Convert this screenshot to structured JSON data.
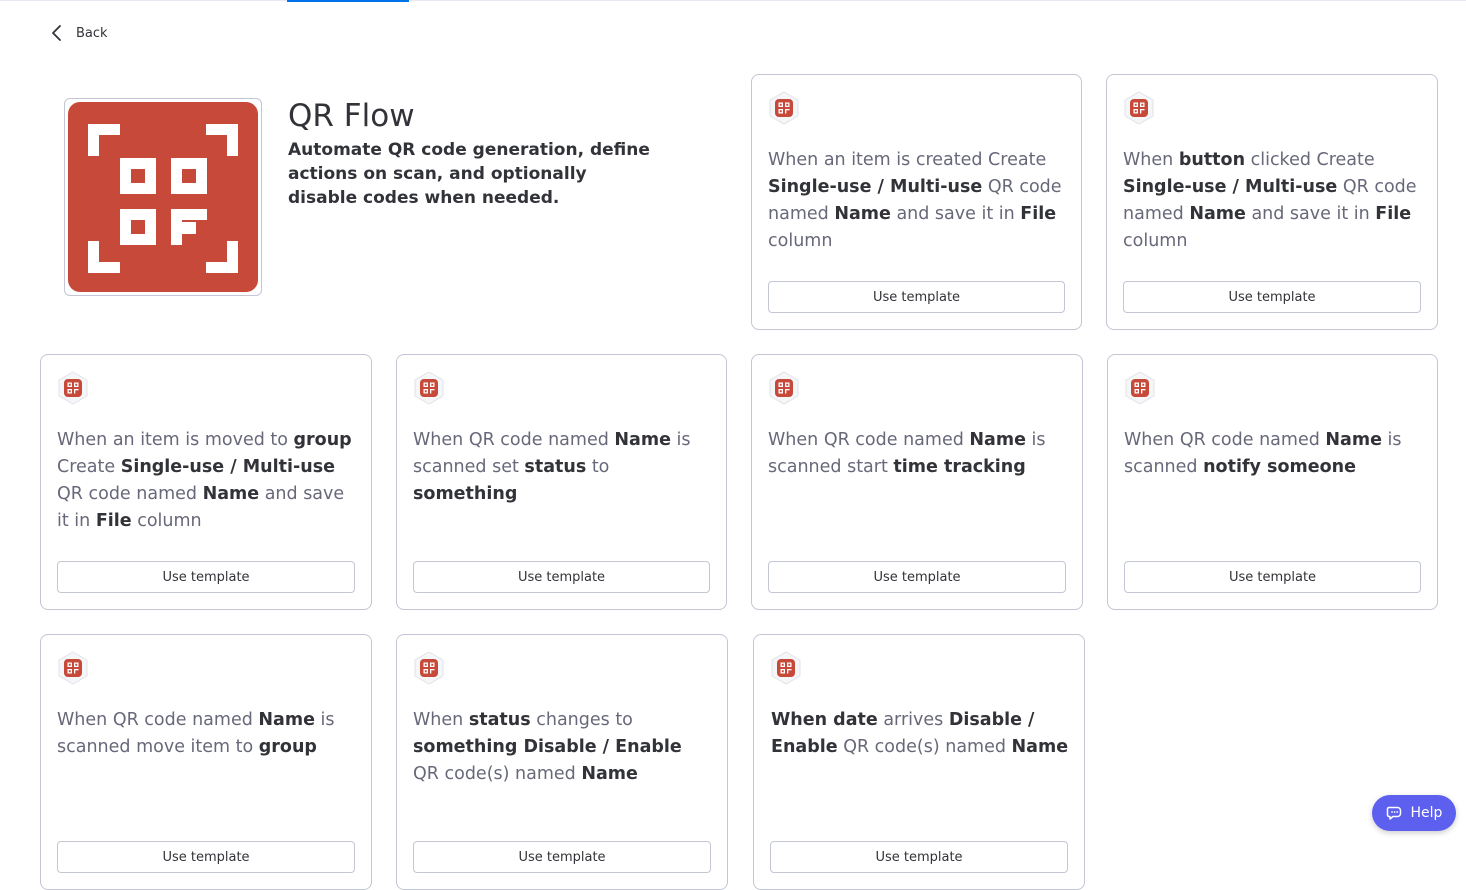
{
  "nav": {
    "back_label": "Back"
  },
  "app": {
    "title": "QR Flow",
    "description": "Automate QR code generation, define actions on scan, and optionally disable codes when needed."
  },
  "colors": {
    "brand": "#c7493a",
    "help": "#5d5fef",
    "accent_tab": "#0073ea"
  },
  "cards": [
    {
      "segments": [
        {
          "t": "When an item is created Create ",
          "b": false
        },
        {
          "t": "Single-use / Multi-use",
          "b": true
        },
        {
          "t": " QR code named ",
          "b": false
        },
        {
          "t": "Name",
          "b": true
        },
        {
          "t": " and save it in ",
          "b": false
        },
        {
          "t": "File",
          "b": true
        },
        {
          "t": " column",
          "b": false
        }
      ],
      "button": "Use template"
    },
    {
      "segments": [
        {
          "t": "When ",
          "b": false
        },
        {
          "t": "button",
          "b": true
        },
        {
          "t": " clicked Create ",
          "b": false
        },
        {
          "t": "Single-use / Multi-use",
          "b": true
        },
        {
          "t": " QR code named ",
          "b": false
        },
        {
          "t": "Name",
          "b": true
        },
        {
          "t": " and save it in ",
          "b": false
        },
        {
          "t": "File",
          "b": true
        },
        {
          "t": " column",
          "b": false
        }
      ],
      "button": "Use template"
    },
    {
      "segments": [
        {
          "t": "When an item is moved to ",
          "b": false
        },
        {
          "t": "group",
          "b": true
        },
        {
          "t": " Create ",
          "b": false
        },
        {
          "t": "Single-use / Multi-use",
          "b": true
        },
        {
          "t": " QR code named ",
          "b": false
        },
        {
          "t": "Name",
          "b": true
        },
        {
          "t": " and save it in ",
          "b": false
        },
        {
          "t": "File",
          "b": true
        },
        {
          "t": " column",
          "b": false
        }
      ],
      "button": "Use template"
    },
    {
      "segments": [
        {
          "t": "When QR code named ",
          "b": false
        },
        {
          "t": "Name",
          "b": true
        },
        {
          "t": " is scanned set ",
          "b": false
        },
        {
          "t": "status",
          "b": true
        },
        {
          "t": " to ",
          "b": false
        },
        {
          "t": "something",
          "b": true
        }
      ],
      "button": "Use template"
    },
    {
      "segments": [
        {
          "t": "When QR code named ",
          "b": false
        },
        {
          "t": "Name",
          "b": true
        },
        {
          "t": " is scanned start ",
          "b": false
        },
        {
          "t": "time tracking",
          "b": true
        }
      ],
      "button": "Use template"
    },
    {
      "segments": [
        {
          "t": "When QR code named ",
          "b": false
        },
        {
          "t": "Name",
          "b": true
        },
        {
          "t": " is scanned ",
          "b": false
        },
        {
          "t": "notify someone",
          "b": true
        }
      ],
      "button": "Use template"
    },
    {
      "segments": [
        {
          "t": "When QR code named ",
          "b": false
        },
        {
          "t": "Name",
          "b": true
        },
        {
          "t": " is scanned move item to ",
          "b": false
        },
        {
          "t": "group",
          "b": true
        }
      ],
      "button": "Use template"
    },
    {
      "segments": [
        {
          "t": "When ",
          "b": false
        },
        {
          "t": "status",
          "b": true
        },
        {
          "t": " changes to ",
          "b": false
        },
        {
          "t": "something Disable / Enable",
          "b": true
        },
        {
          "t": " QR code(s) named ",
          "b": false
        },
        {
          "t": "Name",
          "b": true
        }
      ],
      "button": "Use template"
    },
    {
      "segments": [
        {
          "t": "When date",
          "b": true
        },
        {
          "t": " arrives ",
          "b": false
        },
        {
          "t": "Disable / Enable",
          "b": true
        },
        {
          "t": " QR code(s) named ",
          "b": false
        },
        {
          "t": "Name",
          "b": true
        }
      ],
      "button": "Use template"
    }
  ],
  "help": {
    "label": "Help"
  }
}
